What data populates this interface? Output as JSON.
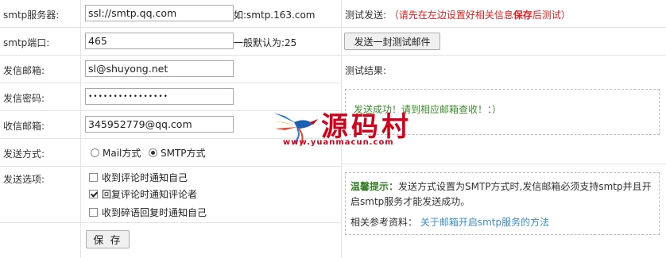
{
  "form": {
    "smtp_server": {
      "label": "smtp服务器:",
      "value": "ssl://smtp.qq.com",
      "hint": "如:smtp.163.com"
    },
    "smtp_port": {
      "label": "smtp端口:",
      "value": "465",
      "hint": "一般默认为:25"
    },
    "sender_email": {
      "label": "发信邮箱:",
      "value": "sl@shuyong.net"
    },
    "sender_password": {
      "label": "发信密码:",
      "value": "••••••••••••••••"
    },
    "receiver_email": {
      "label": "收信邮箱:",
      "value": "345952779@qq.com"
    },
    "send_method": {
      "label": "发送方式:",
      "options": [
        "Mail方式",
        "SMTP方式"
      ],
      "selected": "SMTP方式"
    },
    "send_options": {
      "label": "发送选项:",
      "items": [
        {
          "label": "收到评论时通知自己",
          "checked": false
        },
        {
          "label": "回复评论时通知评论者",
          "checked": true
        },
        {
          "label": "收到碎语回复时通知自己",
          "checked": false
        }
      ]
    },
    "save_button": "保 存"
  },
  "test": {
    "label": "测试发送:",
    "note_open": "（请先在左边设置好相关信息",
    "note_bold": "保存",
    "note_close": "后测试）",
    "button": "发送一封测试邮件",
    "result_label": "测试结果:",
    "result_text": "发送成功！请到相应邮箱查收！：）"
  },
  "tip": {
    "title": "温馨提示：",
    "body": "发送方式设置为SMTP方式时,发信邮箱必须支持smtp并且开启smtp服务才能发送成功。",
    "ref_label": "相关参考资料：",
    "ref_link": "关于邮箱开启smtp服务的方法"
  },
  "watermark": {
    "text": "源码村",
    "url": "www.yuanmacun.com"
  },
  "colors": {
    "accent_red": "#e02020",
    "success_green": "#3c8d2f",
    "link_blue": "#3a8fc5"
  }
}
